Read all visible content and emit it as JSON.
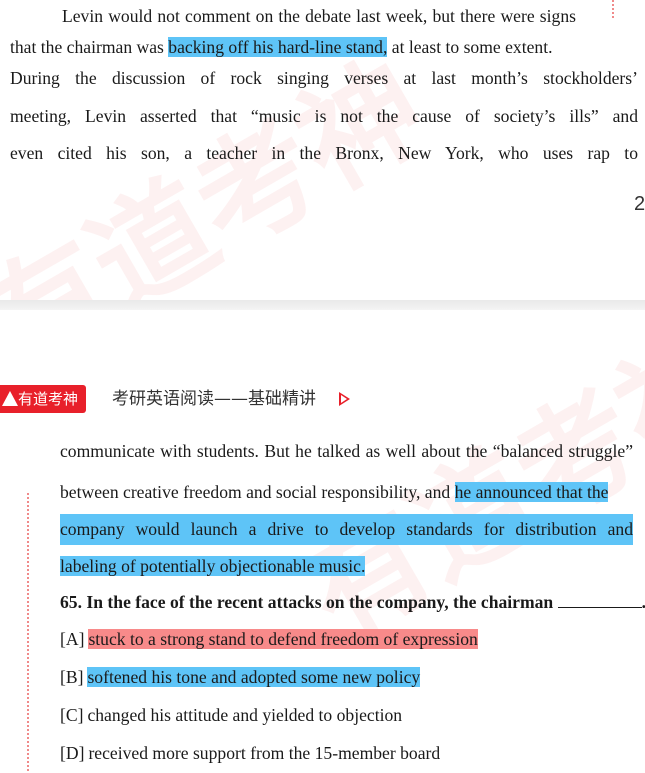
{
  "top_page": {
    "lines": [
      "Levin would not comment on the debate last week, but there were signs",
      "that the chairman was",
      "backing off his hard-line stand,",
      "at least to some extent.",
      "During the discussion of rock singing verses at last month’s stockholders’",
      "meeting, Levin asserted that “music is not the cause of society’s ills” and",
      "even cited his son, a teacher in the Bronx, New York, who uses rap to"
    ],
    "page_number": "2"
  },
  "header": {
    "brand": "有道考神",
    "title": "考研英语阅读——基础精讲",
    "play_icon": "play-triangle-icon"
  },
  "bottom_page": {
    "lines": [
      "communicate with students. But he talked as well about the “balanced struggle”",
      "between creative freedom and social responsibility, and",
      "he announced that the",
      "company would launch a drive to develop standards for distribution and",
      "labeling of potentially objectionable music."
    ],
    "question": "65. In the face of the recent attacks on the company, the chairman",
    "question_end": ".",
    "options": [
      {
        "label": "[A]",
        "text": "stuck to a strong stand to defend freedom of expression"
      },
      {
        "label": "[B]",
        "text": "softened his tone and adopted some new policy"
      },
      {
        "label": "[C]",
        "text": "changed his attitude and yielded to objection"
      },
      {
        "label": "[D]",
        "text": "received more support from the 15-member board"
      }
    ]
  },
  "colors": {
    "highlight_blue": "#5ec4f7",
    "highlight_red": "#f88a8a",
    "brand_red": "#e8202a"
  }
}
